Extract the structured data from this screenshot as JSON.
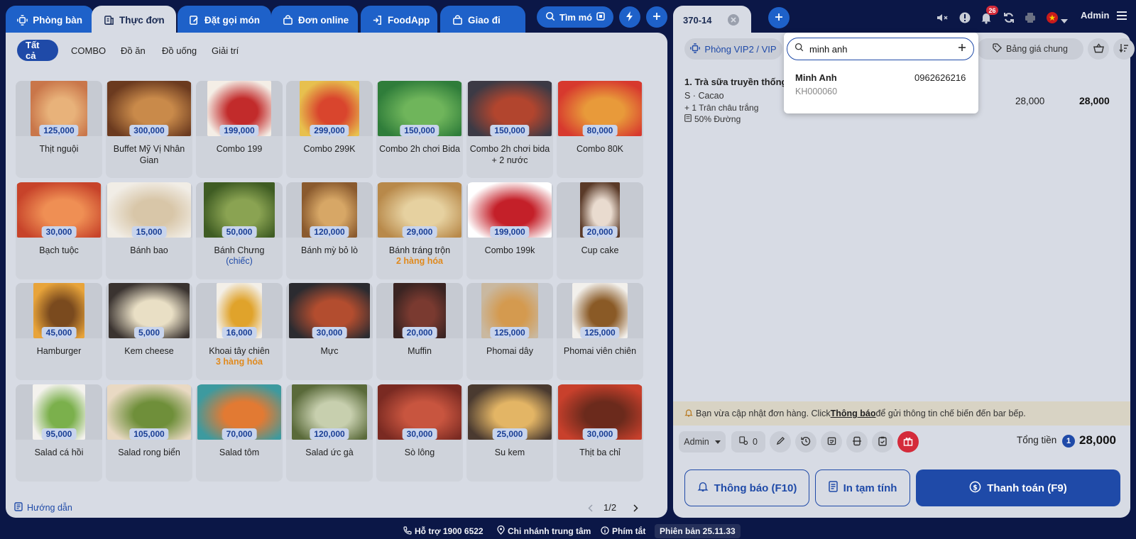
{
  "tabs": [
    {
      "label": "Phòng bàn",
      "icon": "table-icon"
    },
    {
      "label": "Thực đơn",
      "icon": "menu-book-icon"
    },
    {
      "label": "Đặt gọi món",
      "icon": "order-icon"
    },
    {
      "label": "Đơn online",
      "icon": "bag-icon"
    },
    {
      "label": "FoodApp",
      "icon": "login-icon"
    },
    {
      "label": "Giao đi",
      "icon": "bag-icon"
    }
  ],
  "search_button": {
    "label": "Tìm mó"
  },
  "categories": [
    "Tất cả",
    "COMBO",
    "Đồ ăn",
    "Đồ uống",
    "Giải trí"
  ],
  "products": [
    {
      "name": "Thịt nguội",
      "price": "125,000"
    },
    {
      "name": "Buffet Mỹ Vị Nhân Gian",
      "price": "300,000"
    },
    {
      "name": "Combo 199",
      "price": "199,000"
    },
    {
      "name": "Combo 299K",
      "price": "299,000"
    },
    {
      "name": "Combo 2h chơi Bida",
      "price": "150,000"
    },
    {
      "name": "Combo 2h chơi bida + 2 nước",
      "price": "150,000"
    },
    {
      "name": "Combo 80K",
      "price": "80,000"
    },
    {
      "name": "Bạch tuộc",
      "price": "30,000"
    },
    {
      "name": "Bánh bao",
      "price": "15,000"
    },
    {
      "name": "Bánh Chưng",
      "price": "50,000",
      "sub": "(chiếc)",
      "sub_color": "#1f4aa8"
    },
    {
      "name": "Bánh mỳ bỏ lò",
      "price": "120,000"
    },
    {
      "name": "Bánh tráng trộn",
      "price": "29,000",
      "sub": "2 hàng hóa",
      "sub_color": "#e08a1e"
    },
    {
      "name": "Combo 199k",
      "price": "199,000"
    },
    {
      "name": "Cup cake",
      "price": "20,000"
    },
    {
      "name": "Hamburger",
      "price": "45,000"
    },
    {
      "name": "Kem cheese",
      "price": "5,000"
    },
    {
      "name": "Khoai tây chiên",
      "price": "16,000",
      "sub": "3 hàng hóa",
      "sub_color": "#e08a1e"
    },
    {
      "name": "Mực",
      "price": "30,000"
    },
    {
      "name": "Muffin",
      "price": "20,000"
    },
    {
      "name": "Phomai dây",
      "price": "125,000"
    },
    {
      "name": "Phomai viên chiên",
      "price": "125,000"
    },
    {
      "name": "Salad cá hồi",
      "price": "95,000"
    },
    {
      "name": "Salad rong biển",
      "price": "105,000"
    },
    {
      "name": "Salad tôm",
      "price": "70,000"
    },
    {
      "name": "Salad ức gà",
      "price": "120,000"
    },
    {
      "name": "Sò lông",
      "price": "30,000"
    },
    {
      "name": "Su kem",
      "price": "25,000"
    },
    {
      "name": "Thịt ba chỉ",
      "price": "30,000"
    }
  ],
  "guide": {
    "label": "Hướng dẫn"
  },
  "pagination": {
    "label": "1/2"
  },
  "order": {
    "tab_label": "370-14",
    "room_label": "Phòng VIP2 / VIP",
    "search_value": "minh anh",
    "price_list_label": "Bảng giá chung",
    "user_label": "Admin",
    "item": {
      "title": "1. Trà sữa truyền thống",
      "size": "S · Cacao",
      "topping": "+ 1 Trân châu trắng",
      "note": "50% Đường",
      "unit_price": "28,000",
      "total": "28,000"
    },
    "customer": {
      "name": "Minh Anh",
      "phone": "0962626216",
      "code": "KH000060"
    },
    "notice": {
      "before": "Bạn vừa cập nhật đơn hàng. Click ",
      "link": "Thông báo",
      "after": " để gửi thông tin chế biến đến bar bếp."
    },
    "staff_label": "Admin",
    "guest_count": "0",
    "total_label": "Tổng tiền",
    "total_qty": "1",
    "total_value": "28,000",
    "notify_button": "Thông báo (F10)",
    "print_button": "In tạm tính",
    "pay_button": "Thanh toán (F9)",
    "notification_badge": "26"
  },
  "footer": {
    "support": "Hỗ trợ 1900 6522",
    "branch": "Chi nhánh trung tâm",
    "shortcut": "Phím tắt",
    "version": "Phiên bản 25.11.33"
  },
  "colors": {
    "primary": "#1f4aa8",
    "tab": "#1e61c9",
    "background": "#0b1747",
    "orange": "#e08a1e",
    "red": "#d42b3a"
  }
}
